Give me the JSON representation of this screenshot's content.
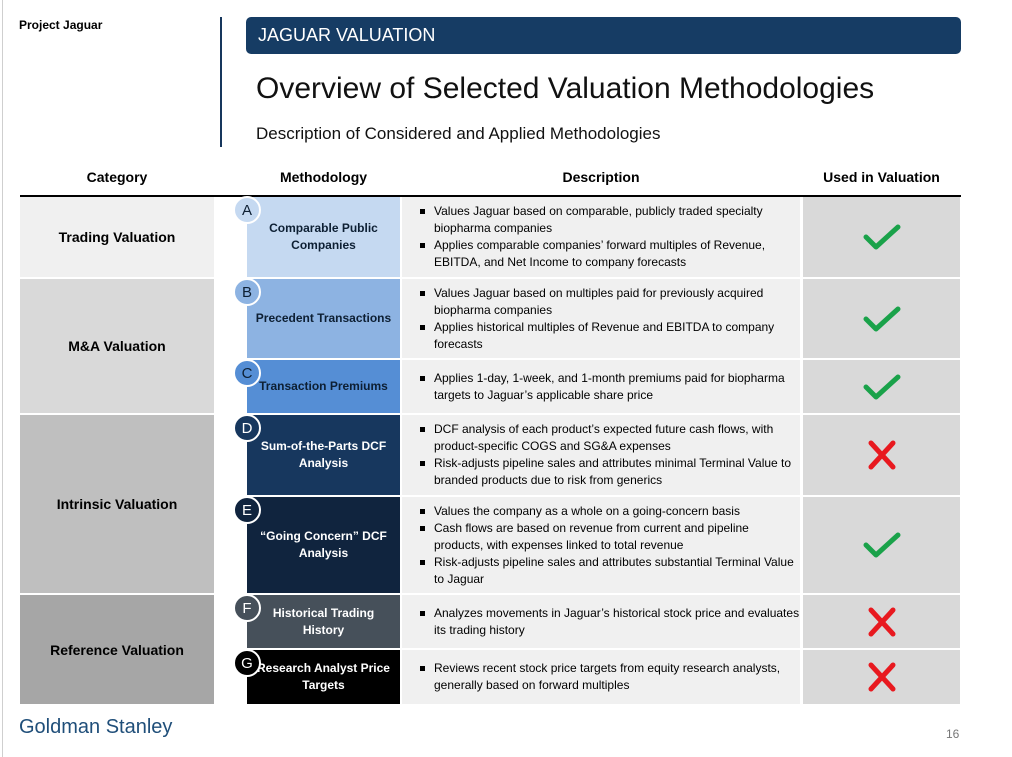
{
  "header": {
    "project": "Project Jaguar",
    "banner": "JAGUAR VALUATION",
    "title": "Overview of Selected Valuation Methodologies",
    "subtitle": "Description of Considered and Applied Methodologies"
  },
  "table": {
    "columns": [
      "Category",
      "Methodology",
      "Description",
      "Used in Valuation"
    ],
    "categories": [
      {
        "label": "Trading Valuation",
        "color": "#f0f0f0"
      },
      {
        "label": "M&A Valuation",
        "color": "#d9d9d9"
      },
      {
        "label": "Intrinsic Valuation",
        "color": "#bfbfbf"
      },
      {
        "label": "Reference Valuation",
        "color": "#a6a6a6"
      }
    ],
    "rows": [
      {
        "letter": "A",
        "methodology": "Comparable Public Companies",
        "fill": "#c5d9f1",
        "text_color": "#0d1f33",
        "bullets": [
          "Values Jaguar based on comparable, publicly traded specialty biopharma companies",
          "Applies comparable companies’ forward multiples of Revenue, EBITDA, and Net Income to company forecasts"
        ],
        "used": true
      },
      {
        "letter": "B",
        "methodology": "Precedent Transactions",
        "fill": "#8db3e2",
        "text_color": "#0d1f33",
        "bullets": [
          "Values Jaguar based on multiples paid for previously acquired biopharma companies",
          "Applies historical multiples of Revenue and EBITDA to company forecasts"
        ],
        "used": true
      },
      {
        "letter": "C",
        "methodology": "Transaction Premiums",
        "fill": "#558ed5",
        "text_color": "#0d1f33",
        "bullets": [
          "Applies 1-day, 1-week, and 1-month premiums paid for biopharma targets to Jaguar’s applicable share price"
        ],
        "used": true
      },
      {
        "letter": "D",
        "methodology": "Sum-of-the-Parts DCF Analysis",
        "fill": "#17375e",
        "text_color": "#ffffff",
        "bullets": [
          "DCF analysis of each product’s expected future cash flows, with product-specific COGS and SG&A expenses",
          "Risk-adjusts pipeline sales and attributes minimal Terminal Value to branded products due to risk from generics"
        ],
        "used": false
      },
      {
        "letter": "E",
        "methodology": "“Going Concern” DCF Analysis",
        "fill": "#10243e",
        "text_color": "#ffffff",
        "bullets": [
          "Values the company as a whole on a going-concern basis",
          "Cash flows are based on revenue from current and pipeline products, with expenses linked to total revenue",
          "Risk-adjusts pipeline sales and attributes substantial Terminal Value to Jaguar"
        ],
        "used": true
      },
      {
        "letter": "F",
        "methodology": "Historical Trading History",
        "fill": "#46505a",
        "text_color": "#ffffff",
        "bullets": [
          "Analyzes movements in Jaguar’s historical stock price and evaluates its trading history"
        ],
        "used": false
      },
      {
        "letter": "G",
        "methodology": "Research Analyst Price Targets",
        "fill": "#000000",
        "text_color": "#ffffff",
        "bullets": [
          "Reviews recent stock price targets from equity research analysts, generally based on forward multiples"
        ],
        "used": false
      }
    ]
  },
  "colors": {
    "check": "#1aa24a",
    "cross": "#e8191f",
    "banner": "#163c64"
  },
  "footer": {
    "brand": "Goldman Stanley",
    "page": "16"
  }
}
